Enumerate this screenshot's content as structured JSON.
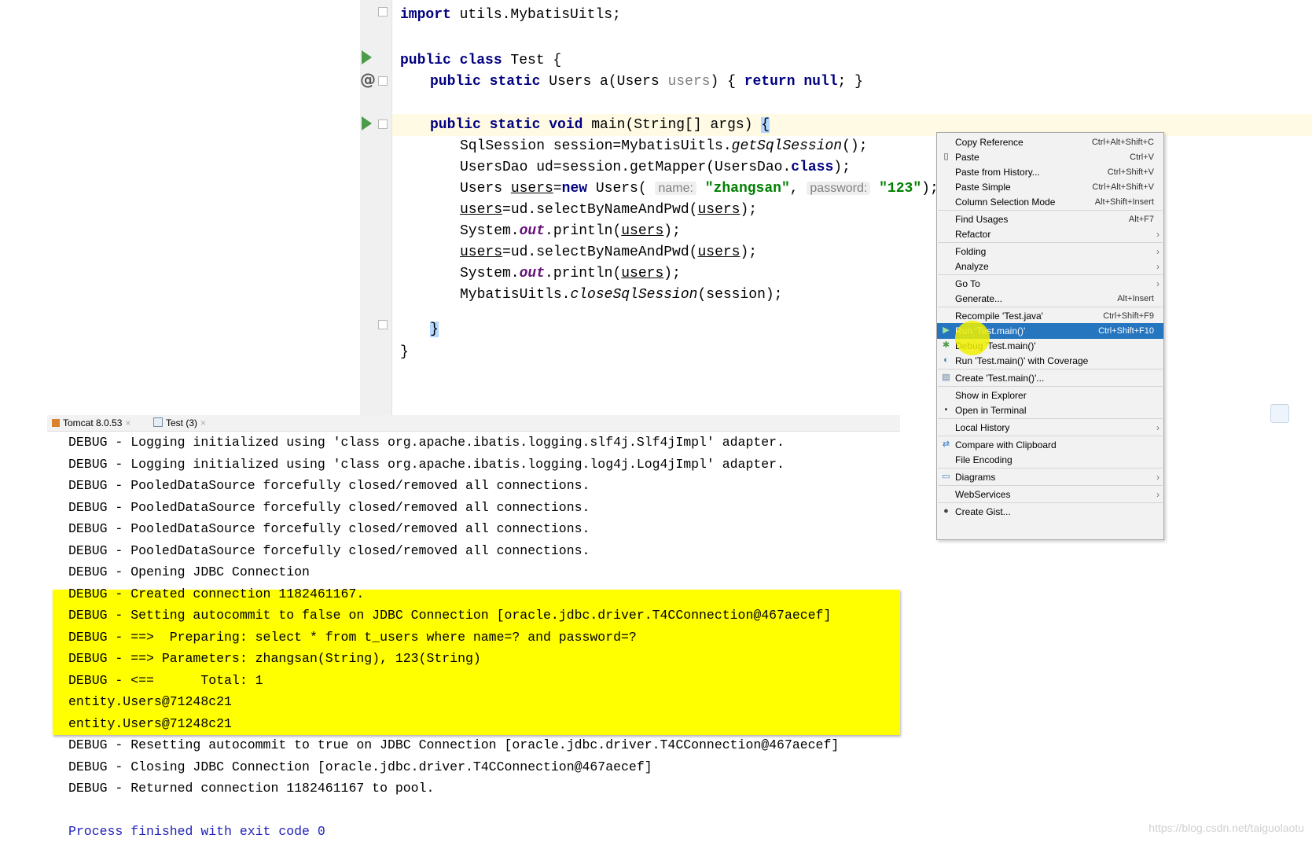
{
  "editor": {
    "lines": {
      "import": {
        "kw": "import",
        "text": " utils.MybatisUitls;"
      },
      "class_decl": {
        "kw": "public class",
        "text": " Test {"
      },
      "method_a": {
        "kw": "public static",
        "pre": " Users a(Users ",
        "param": "users",
        "post": ")",
        "brace1": " {",
        "ret": " return null",
        "semi": ";",
        "brace2": " }"
      },
      "main_decl": {
        "kw": "public static void",
        "text": " main(String[] args) ",
        "brace": "{"
      },
      "l1_pre": "SqlSession session=MybatisUitls.",
      "l1_it": "getSqlSession",
      "l1_post": "();",
      "l2_pre": "UsersDao ud=session.getMapper(UsersDao.",
      "l2_kw": "class",
      "l2_post": ");",
      "l3_pre": "Users ",
      "l3_var": "users",
      "l3_eq": "=",
      "l3_new": "new",
      "l3_cls": " Users( ",
      "l3_hint1": "name:",
      "l3_str1": "\"zhangsan\"",
      "l3_comma": ", ",
      "l3_hint2": "password:",
      "l3_str2": "\"123\"",
      "l3_end": ");",
      "l4_var": "users",
      "l4_mid": "=ud.selectByNameAndPwd(",
      "l4_arg": "users",
      "l4_end": ");",
      "l5_pre": "System.",
      "l5_out": "out",
      "l5_mid": ".println(",
      "l5_arg": "users",
      "l5_end": ");",
      "l6_var": "users",
      "l6_mid": "=ud.selectByNameAndPwd(",
      "l6_arg": "users",
      "l6_end": ");",
      "l7_pre": "System.",
      "l7_out": "out",
      "l7_mid": ".println(",
      "l7_arg": "users",
      "l7_end": ");",
      "l8_pre": "MybatisUitls.",
      "l8_it": "closeSqlSession",
      "l8_post": "(session);",
      "close_main": "}",
      "close_class": "}"
    }
  },
  "console_tabs": [
    {
      "label": "Tomcat 8.0.53",
      "close": "×"
    },
    {
      "label": "Test (3)",
      "close": "×"
    }
  ],
  "console": {
    "lines": [
      "DEBUG - Logging initialized using 'class org.apache.ibatis.logging.slf4j.Slf4jImpl' adapter.",
      "DEBUG - Logging initialized using 'class org.apache.ibatis.logging.log4j.Log4jImpl' adapter.",
      "DEBUG - PooledDataSource forcefully closed/removed all connections.",
      "DEBUG - PooledDataSource forcefully closed/removed all connections.",
      "DEBUG - PooledDataSource forcefully closed/removed all connections.",
      "DEBUG - PooledDataSource forcefully closed/removed all connections.",
      "DEBUG - Opening JDBC Connection",
      "DEBUG - Created connection 1182461167.",
      "DEBUG - Setting autocommit to false on JDBC Connection [oracle.jdbc.driver.T4CConnection@467aecef]",
      "DEBUG - ==>  Preparing: select * from t_users where name=? and password=?",
      "DEBUG - ==> Parameters: zhangsan(String), 123(String)",
      "DEBUG - <==      Total: 1",
      "entity.Users@71248c21",
      "entity.Users@71248c21",
      "DEBUG - Resetting autocommit to true on JDBC Connection [oracle.jdbc.driver.T4CConnection@467aecef]",
      "DEBUG - Closing JDBC Connection [oracle.jdbc.driver.T4CConnection@467aecef]",
      "DEBUG - Returned connection 1182461167 to pool.",
      "",
      "Process finished with exit code 0"
    ]
  },
  "context_menu": {
    "items": [
      {
        "label": "Copy Reference",
        "shortcut": "Ctrl+Alt+Shift+C",
        "icon": ""
      },
      {
        "label": "Paste",
        "shortcut": "Ctrl+V",
        "icon": "clipboard-icon"
      },
      {
        "label": "Paste from History...",
        "shortcut": "Ctrl+Shift+V",
        "icon": ""
      },
      {
        "label": "Paste Simple",
        "shortcut": "Ctrl+Alt+Shift+V",
        "icon": ""
      },
      {
        "label": "Column Selection Mode",
        "shortcut": "Alt+Shift+Insert",
        "icon": ""
      },
      {
        "label": "Find Usages",
        "shortcut": "Alt+F7",
        "icon": ""
      },
      {
        "label": "Refactor",
        "shortcut": "",
        "icon": "",
        "submenu": true
      },
      {
        "label": "Folding",
        "shortcut": "",
        "icon": "",
        "submenu": true
      },
      {
        "label": "Analyze",
        "shortcut": "",
        "icon": "",
        "submenu": true
      },
      {
        "label": "Go To",
        "shortcut": "",
        "icon": "",
        "submenu": true
      },
      {
        "label": "Generate...",
        "shortcut": "Alt+Insert",
        "icon": ""
      },
      {
        "label": "Recompile 'Test.java'",
        "shortcut": "Ctrl+Shift+F9",
        "icon": ""
      },
      {
        "label": "Run 'Test.main()'",
        "shortcut": "Ctrl+Shift+F10",
        "icon": "run-icon",
        "selected": true
      },
      {
        "label": "Debug 'Test.main()'",
        "shortcut": "",
        "icon": "bug-icon"
      },
      {
        "label": "Run 'Test.main()' with Coverage",
        "shortcut": "",
        "icon": "coverage-icon"
      },
      {
        "label": "Create 'Test.main()'...",
        "shortcut": "",
        "icon": "create-config-icon"
      },
      {
        "label": "Show in Explorer",
        "shortcut": "",
        "icon": ""
      },
      {
        "label": "Open in Terminal",
        "shortcut": "",
        "icon": "terminal-icon"
      },
      {
        "label": "Local History",
        "shortcut": "",
        "icon": "",
        "submenu": true
      },
      {
        "label": "Compare with Clipboard",
        "shortcut": "",
        "icon": "compare-icon"
      },
      {
        "label": "File Encoding",
        "shortcut": "",
        "icon": ""
      },
      {
        "label": "Diagrams",
        "shortcut": "",
        "icon": "diagram-icon",
        "submenu": true
      },
      {
        "label": "WebServices",
        "shortcut": "",
        "icon": "",
        "submenu": true
      },
      {
        "label": "Create Gist...",
        "shortcut": "",
        "icon": "github-icon"
      }
    ],
    "submenu_arrow": "›"
  },
  "watermark": "https://blog.csdn.net/taiguolaotu",
  "colors": {
    "keyword": "#000080",
    "string": "#008000",
    "highlight": "#ffff00",
    "menu_selected": "#2675bf",
    "run_green": "#4b9b4b"
  }
}
